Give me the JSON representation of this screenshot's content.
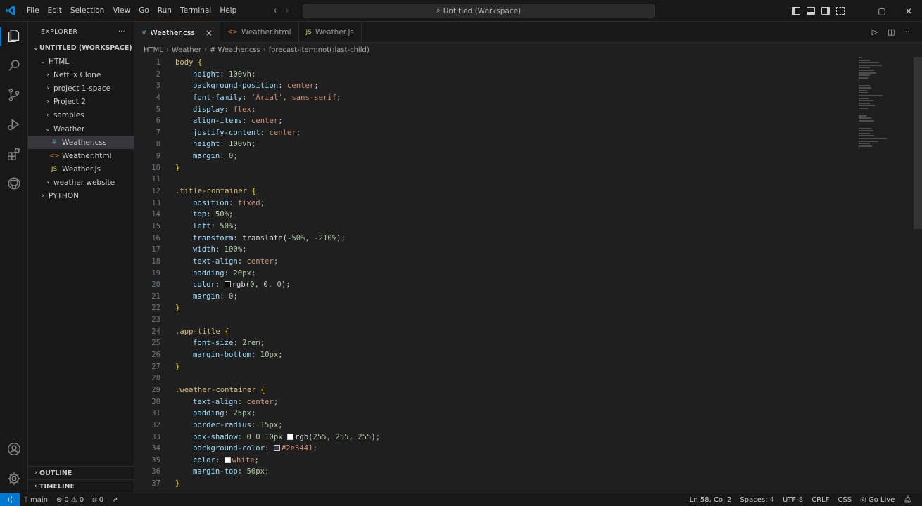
{
  "menu": [
    "File",
    "Edit",
    "Selection",
    "View",
    "Go",
    "Run",
    "Terminal",
    "Help"
  ],
  "search": {
    "text": "Untitled (Workspace)"
  },
  "explorer": {
    "header": "EXPLORER",
    "more": "···",
    "workspace": "UNTITLED (WORKSPACE)",
    "tree": [
      {
        "label": "HTML",
        "type": "folder",
        "open": true,
        "depth": 0
      },
      {
        "label": "Netflix Clone",
        "type": "folder",
        "open": false,
        "depth": 1
      },
      {
        "label": "project 1-space",
        "type": "folder",
        "open": false,
        "depth": 1
      },
      {
        "label": "Project 2",
        "type": "folder",
        "open": false,
        "depth": 1
      },
      {
        "label": "samples",
        "type": "folder",
        "open": false,
        "depth": 1
      },
      {
        "label": "Weather",
        "type": "folder",
        "open": true,
        "depth": 1
      },
      {
        "label": "Weather.css",
        "type": "css",
        "depth": 2,
        "selected": true
      },
      {
        "label": "Weather.html",
        "type": "html",
        "depth": 2
      },
      {
        "label": "Weather.js",
        "type": "js",
        "depth": 2
      },
      {
        "label": "weather website",
        "type": "folder",
        "open": false,
        "depth": 1
      },
      {
        "label": "PYTHON",
        "type": "folder",
        "open": false,
        "depth": 0
      }
    ],
    "outline": "OUTLINE",
    "timeline": "TIMELINE"
  },
  "tabs": [
    {
      "label": "Weather.css",
      "icon": "#",
      "icon_color": "#519aba",
      "active": true,
      "close": "×"
    },
    {
      "label": "Weather.html",
      "icon": "<>",
      "icon_color": "#e37933",
      "active": false
    },
    {
      "label": "Weather.js",
      "icon": "JS",
      "icon_color": "#cbcb41",
      "active": false
    }
  ],
  "breadcrumb": [
    "HTML",
    "Weather",
    "# Weather.css",
    "forecast-item:not(:last-child)"
  ],
  "code": [
    [
      [
        "sel",
        "body "
      ],
      [
        "brace",
        "{"
      ]
    ],
    [
      [
        "ind",
        ""
      ],
      [
        "prop",
        "height"
      ],
      [
        "punct",
        ": "
      ],
      [
        "num",
        "100vh"
      ],
      [
        "punct",
        ";"
      ]
    ],
    [
      [
        "ind",
        ""
      ],
      [
        "prop",
        "background-position"
      ],
      [
        "punct",
        ": "
      ],
      [
        "val",
        "center"
      ],
      [
        "punct",
        ";"
      ]
    ],
    [
      [
        "ind",
        ""
      ],
      [
        "prop",
        "font-family"
      ],
      [
        "punct",
        ": "
      ],
      [
        "val",
        "'Arial', sans-serif"
      ],
      [
        "punct",
        ";"
      ]
    ],
    [
      [
        "ind",
        ""
      ],
      [
        "prop",
        "display"
      ],
      [
        "punct",
        ": "
      ],
      [
        "val",
        "flex"
      ],
      [
        "punct",
        ";"
      ]
    ],
    [
      [
        "ind",
        ""
      ],
      [
        "prop",
        "align-items"
      ],
      [
        "punct",
        ": "
      ],
      [
        "val",
        "center"
      ],
      [
        "punct",
        ";"
      ]
    ],
    [
      [
        "ind",
        ""
      ],
      [
        "prop",
        "justify-content"
      ],
      [
        "punct",
        ": "
      ],
      [
        "val",
        "center"
      ],
      [
        "punct",
        ";"
      ]
    ],
    [
      [
        "ind",
        ""
      ],
      [
        "prop",
        "height"
      ],
      [
        "punct",
        ": "
      ],
      [
        "num",
        "100vh"
      ],
      [
        "punct",
        ";"
      ]
    ],
    [
      [
        "ind",
        ""
      ],
      [
        "prop",
        "margin"
      ],
      [
        "punct",
        ": "
      ],
      [
        "num",
        "0"
      ],
      [
        "punct",
        ";"
      ]
    ],
    [
      [
        "brace",
        "}"
      ]
    ],
    [],
    [
      [
        "sel",
        ".title-container "
      ],
      [
        "brace",
        "{"
      ]
    ],
    [
      [
        "ind",
        ""
      ],
      [
        "prop",
        "position"
      ],
      [
        "punct",
        ": "
      ],
      [
        "val",
        "fixed"
      ],
      [
        "punct",
        ";"
      ]
    ],
    [
      [
        "ind",
        ""
      ],
      [
        "prop",
        "top"
      ],
      [
        "punct",
        ": "
      ],
      [
        "num",
        "50%"
      ],
      [
        "punct",
        ";"
      ]
    ],
    [
      [
        "ind",
        ""
      ],
      [
        "prop",
        "left"
      ],
      [
        "punct",
        ": "
      ],
      [
        "num",
        "50%"
      ],
      [
        "punct",
        ";"
      ]
    ],
    [
      [
        "ind",
        ""
      ],
      [
        "prop",
        "transform"
      ],
      [
        "punct",
        ": "
      ],
      [
        "kw",
        "translate("
      ],
      [
        "num",
        "-50%"
      ],
      [
        "punct",
        ", "
      ],
      [
        "num",
        "-210%"
      ],
      [
        "kw",
        ")"
      ],
      [
        "punct",
        ";"
      ]
    ],
    [
      [
        "ind",
        ""
      ],
      [
        "prop",
        "width"
      ],
      [
        "punct",
        ": "
      ],
      [
        "num",
        "100%"
      ],
      [
        "punct",
        ";"
      ]
    ],
    [
      [
        "ind",
        ""
      ],
      [
        "prop",
        "text-align"
      ],
      [
        "punct",
        ": "
      ],
      [
        "val",
        "center"
      ],
      [
        "punct",
        ";"
      ]
    ],
    [
      [
        "ind",
        ""
      ],
      [
        "prop",
        "padding"
      ],
      [
        "punct",
        ": "
      ],
      [
        "num",
        "20px"
      ],
      [
        "punct",
        ";"
      ]
    ],
    [
      [
        "ind",
        ""
      ],
      [
        "prop",
        "color"
      ],
      [
        "punct",
        ": "
      ],
      [
        "swatch",
        "#000000"
      ],
      [
        "kw",
        "rgb("
      ],
      [
        "num",
        "0, 0, 0"
      ],
      [
        "kw",
        ")"
      ],
      [
        "punct",
        ";"
      ]
    ],
    [
      [
        "ind",
        ""
      ],
      [
        "prop",
        "margin"
      ],
      [
        "punct",
        ": "
      ],
      [
        "num",
        "0"
      ],
      [
        "punct",
        ";"
      ]
    ],
    [
      [
        "brace",
        "}"
      ]
    ],
    [],
    [
      [
        "sel",
        ".app-title "
      ],
      [
        "brace",
        "{"
      ]
    ],
    [
      [
        "ind",
        ""
      ],
      [
        "prop",
        "font-size"
      ],
      [
        "punct",
        ": "
      ],
      [
        "num",
        "2rem"
      ],
      [
        "punct",
        ";"
      ]
    ],
    [
      [
        "ind",
        ""
      ],
      [
        "prop",
        "margin-bottom"
      ],
      [
        "punct",
        ": "
      ],
      [
        "num",
        "10px"
      ],
      [
        "punct",
        ";"
      ]
    ],
    [
      [
        "brace",
        "}"
      ]
    ],
    [],
    [
      [
        "sel",
        ".weather-container "
      ],
      [
        "brace",
        "{"
      ]
    ],
    [
      [
        "ind",
        ""
      ],
      [
        "prop",
        "text-align"
      ],
      [
        "punct",
        ": "
      ],
      [
        "val",
        "center"
      ],
      [
        "punct",
        ";"
      ]
    ],
    [
      [
        "ind",
        ""
      ],
      [
        "prop",
        "padding"
      ],
      [
        "punct",
        ": "
      ],
      [
        "num",
        "25px"
      ],
      [
        "punct",
        ";"
      ]
    ],
    [
      [
        "ind",
        ""
      ],
      [
        "prop",
        "border-radius"
      ],
      [
        "punct",
        ": "
      ],
      [
        "num",
        "15px"
      ],
      [
        "punct",
        ";"
      ]
    ],
    [
      [
        "ind",
        ""
      ],
      [
        "prop",
        "box-shadow"
      ],
      [
        "punct",
        ": "
      ],
      [
        "num",
        "0 0 10px "
      ],
      [
        "swatch",
        "#ffffff"
      ],
      [
        "kw",
        "rgb("
      ],
      [
        "num",
        "255, 255, 255"
      ],
      [
        "kw",
        ")"
      ],
      [
        "punct",
        ";"
      ]
    ],
    [
      [
        "ind",
        ""
      ],
      [
        "prop",
        "background-color"
      ],
      [
        "punct",
        ": "
      ],
      [
        "swatch",
        "#2e3441"
      ],
      [
        "val",
        "#2e3441"
      ],
      [
        "punct",
        ";"
      ]
    ],
    [
      [
        "ind",
        ""
      ],
      [
        "prop",
        "color"
      ],
      [
        "punct",
        ": "
      ],
      [
        "swatch",
        "#ffffff"
      ],
      [
        "val",
        "white"
      ],
      [
        "punct",
        ";"
      ]
    ],
    [
      [
        "ind",
        ""
      ],
      [
        "prop",
        "margin-top"
      ],
      [
        "punct",
        ": "
      ],
      [
        "num",
        "50px"
      ],
      [
        "punct",
        ";"
      ]
    ],
    [
      [
        "brace",
        "}"
      ]
    ]
  ],
  "status": {
    "branch": "main",
    "errors": "0",
    "warnings": "0",
    "ports": "0",
    "position": "Ln 58, Col 2",
    "spaces": "Spaces: 4",
    "encoding": "UTF-8",
    "eol": "CRLF",
    "language": "CSS",
    "golive": "Go Live"
  },
  "colors": {
    "accent": "#0078d4",
    "background": "#1f1f1f",
    "sidebar": "#181818"
  }
}
